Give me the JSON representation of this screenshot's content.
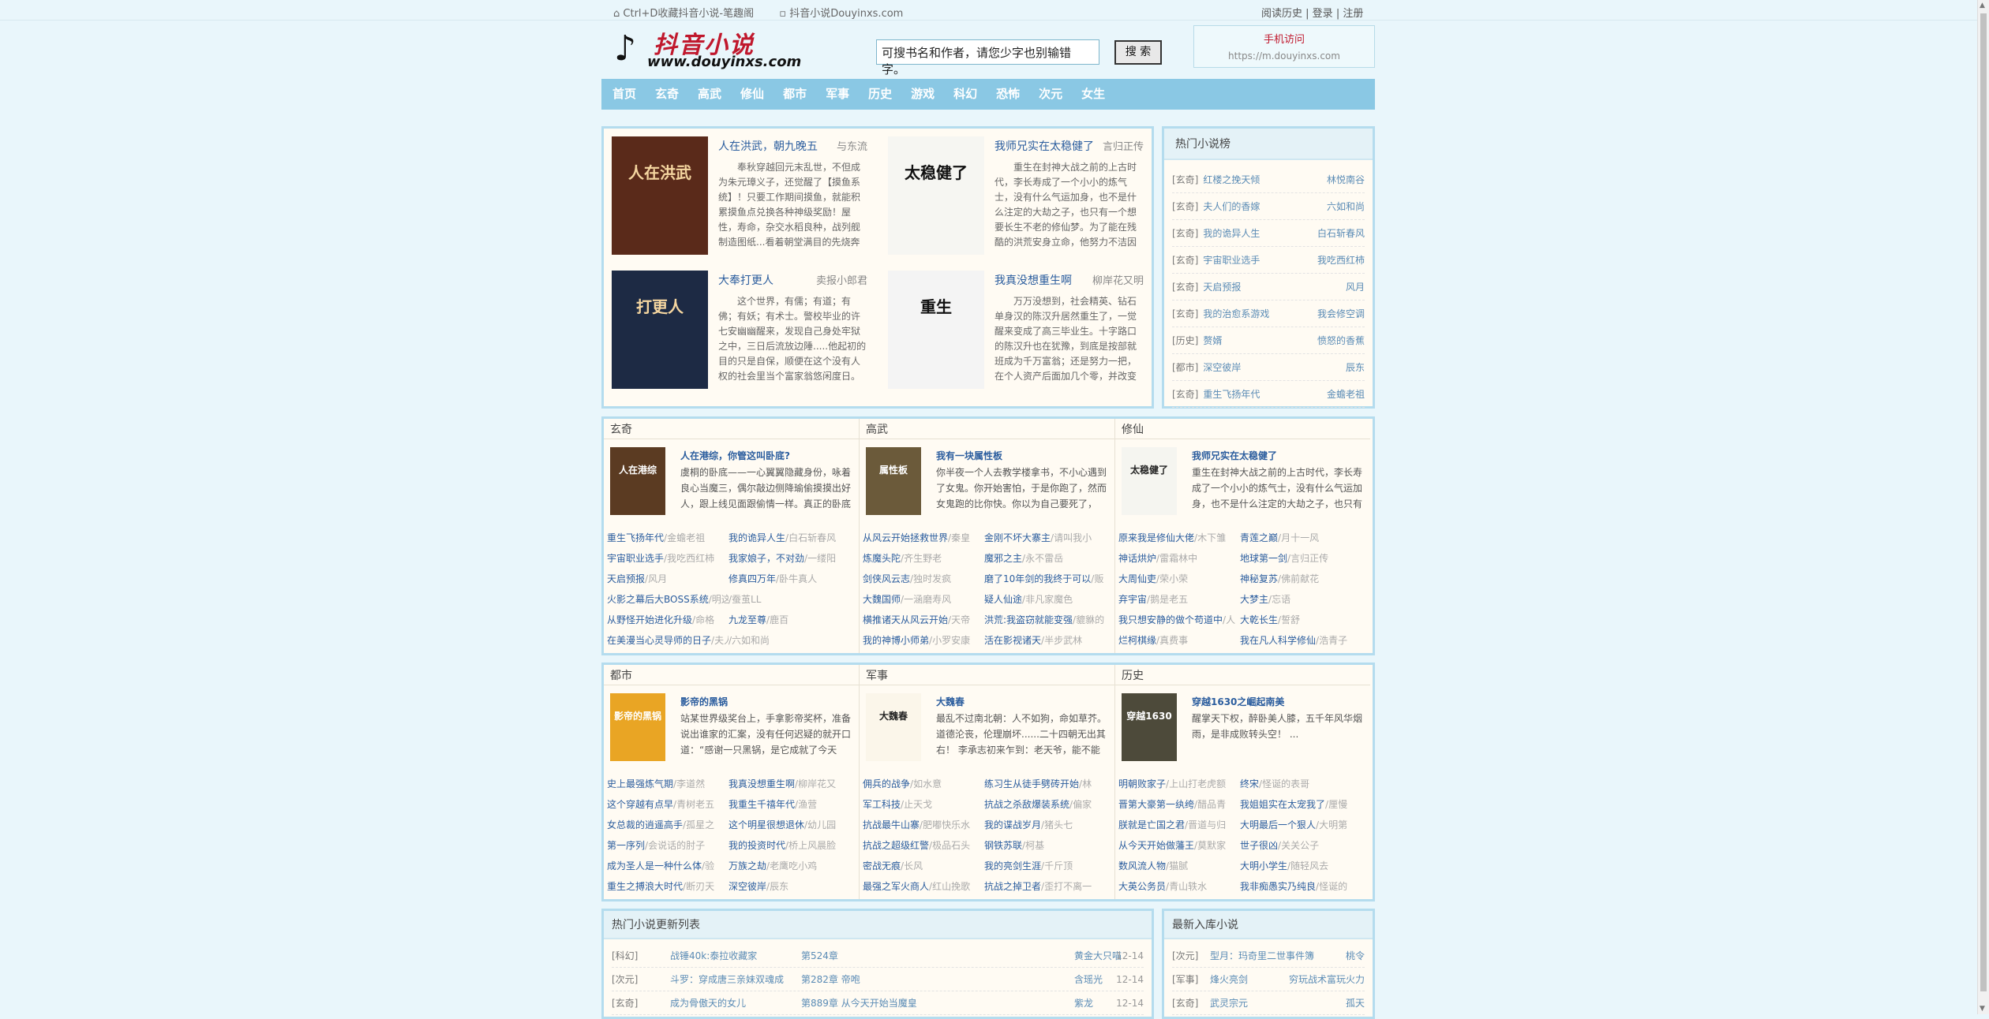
{
  "topbar": {
    "bookmark": "Ctrl+D收藏抖音小说-笔趣阁",
    "site": "抖音小说Douyinxs.com",
    "history": "阅读历史",
    "sep": " | ",
    "login": "登录",
    "register": "注册"
  },
  "logo": {
    "cn": "抖音小说",
    "url": "www.douyinxs.com"
  },
  "search": {
    "value": "可搜书名和作者，请您少字也别输错字。",
    "button": "搜 索"
  },
  "mobile": {
    "title": "手机访问",
    "url": "https://m.douyinxs.com"
  },
  "nav": [
    "首页",
    "玄奇",
    "高武",
    "修仙",
    "都市",
    "军事",
    "历史",
    "游戏",
    "科幻",
    "恐怖",
    "次元",
    "女生"
  ],
  "featured": [
    {
      "title": "人在洪武，朝九晚五",
      "author": "与东流",
      "desc": "奉秋穿越回元末乱世，不但成为朱元璋义子，还觉醒了【摸鱼系统】！只要工作期间摸鱼，就能积累摸鱼点兑换各种神级奖励！屋性，寿命，杂交水稻良种，战列舰制造图纸...看着朝堂满目的先烧奔",
      "cover": "人在洪武",
      "bg": "#5a2a1a"
    },
    {
      "title": "我师兄实在太稳健了",
      "author": "言归正传",
      "desc": "重生在封神大战之前的上古时代，李长寿成了一个小小的炼气士，没有什么气运加身，也不是什么注定的大劫之子，也只有一个想要长生不老的修仙梦。为了能在残酷的洪荒安身立命，他努力不洁因",
      "cover": "太稳健了",
      "bg": "#f6f6f2"
    },
    {
      "title": "大奉打更人",
      "author": "卖报小郎君",
      "desc": "这个世界，有儒；有道；有佛；有妖；有术士。警校毕业的许七安幽幽醒来，发现自己身处牢狱之中，三日后流放边陲.....他起初的目的只是自保，顺便在这个没有人权的社会里当个富家翁悠闲度日。",
      "cover": "打更人",
      "bg": "#1d2a44"
    },
    {
      "title": "我真没想重生啊",
      "author": "柳岸花又明",
      "desc": "万万没想到，社会精英、钻石单身汉的陈汉升居然重生了，一觉醒来变成了高三毕业生。十字路口的陈汉升也在犹豫，到底是按部就班成为千万富翁；还是努力一把，在个人资产后面加几个零，并改变",
      "cover": "重生",
      "bg": "#f4f4f4"
    }
  ],
  "hot": {
    "title": "热门小说榜",
    "rows": [
      {
        "c": "[玄奇]",
        "n": "红楼之挽天倾",
        "a": "林悦南谷"
      },
      {
        "c": "[玄奇]",
        "n": "夫人们的香嫁",
        "a": "六如和尚"
      },
      {
        "c": "[玄奇]",
        "n": "我的诡异人生",
        "a": "白石斩春风"
      },
      {
        "c": "[玄奇]",
        "n": "宇宙职业选手",
        "a": "我吃西红柿"
      },
      {
        "c": "[玄奇]",
        "n": "天启预报",
        "a": "风月"
      },
      {
        "c": "[玄奇]",
        "n": "我的治愈系游戏",
        "a": "我会修空调"
      },
      {
        "c": "[历史]",
        "n": "赘婿",
        "a": "愤怒的香蕉"
      },
      {
        "c": "[都市]",
        "n": "深空彼岸",
        "a": "辰东"
      },
      {
        "c": "[玄奇]",
        "n": "重生飞扬年代",
        "a": "金蟾老祖"
      }
    ]
  },
  "cat1": [
    {
      "name": "玄奇",
      "bt": "人在港综，你管这叫卧底?",
      "bd": "虞桐的卧底——一心翼翼隐藏身份，咏着良心当魔三，偶尔敲边侧降瑜偷摸摸出好人，跟上线见面跟偷情一样。真正的卧底",
      "cover": "人在港综",
      "bg": "#5b3b22",
      "list": [
        [
          "重生飞扬年代",
          "金蟾老祖"
        ],
        [
          "我的诡异人生",
          "白石斩春风"
        ],
        [
          "宇宙职业选手",
          "我吃西红柿"
        ],
        [
          "我家娘子，不对劲",
          "一缕阳"
        ],
        [
          "天启预报",
          "风月"
        ],
        [
          "修真四万年",
          "卧牛真人"
        ],
        [
          "火影之幕后大BOSS系统",
          "明这游戏也太真实了"
        ],
        [
          "",
          "蚕茧LL"
        ],
        [
          "从野怪开始进化升级",
          "命格"
        ],
        [
          "九龙至尊",
          "鹿百"
        ],
        [
          "在美漫当心灵导师的日子",
          "夫人们的香嫁"
        ],
        [
          "",
          "六如和尚"
        ]
      ]
    },
    {
      "name": "高武",
      "bt": "我有一块属性板",
      "bd": "你半夜一个人去教学楼拿书，不小心遇到了女鬼。你开始害怕，于是你跑了，然而女鬼跑的比你快。你以为自己要死了，",
      "cover": "属性板",
      "bg": "#6b5a3a",
      "list": [
        [
          "从风云开始拯救世界",
          "秦皇"
        ],
        [
          "金刚不坏大寨主",
          "请叫我小"
        ],
        [
          "炼魔头陀",
          "齐生野老"
        ],
        [
          "魔邪之主",
          "永不雷岳"
        ],
        [
          "剑侠风云志",
          "独时发疯"
        ],
        [
          "磨了10年剑的我终于可以",
          "贩"
        ],
        [
          "大魏国师",
          "一涵磨寿风"
        ],
        [
          "疑人仙途",
          "非凡家魔色"
        ],
        [
          "横推诸天从风云开始",
          "天帝"
        ],
        [
          "洪荒:我盗窃就能变强",
          "貔貅的"
        ],
        [
          "我的神博小师弟",
          "小罗安康"
        ],
        [
          "活在影视诸天",
          "半步武林"
        ]
      ]
    },
    {
      "name": "修仙",
      "bt": "我师兄实在太稳健了",
      "bd": "重生在封神大战之前的上古时代，李长寿成了一个小小的炼气士，没有什么气运加身，也不是什么注定的大劫之子，也只有",
      "cover": "太稳健了",
      "bg": "#f5f5f0",
      "list": [
        [
          "原来我是修仙大佬",
          "木下雏"
        ],
        [
          "青莲之巅",
          "月十一风"
        ],
        [
          "神话烘炉",
          "雷霜林中"
        ],
        [
          "地球第一剑",
          "言归正传"
        ],
        [
          "大周仙吏",
          "荣小荣"
        ],
        [
          "神秘复苏",
          "佛前献花"
        ],
        [
          "弃宇宙",
          "鹅是老五"
        ],
        [
          "大梦主",
          "忘语"
        ],
        [
          "我只想安静的做个苟道中",
          "人"
        ],
        [
          "大乾长生",
          "誓舒"
        ],
        [
          "烂柯棋缘",
          "真费事"
        ],
        [
          "我在凡人科学修仙",
          "浩青子"
        ]
      ]
    }
  ],
  "cat2": [
    {
      "name": "都市",
      "bt": "影帝的黑锅",
      "bd": "站某世界级奖台上，手拿影帝奖杯，准备说出谁家的汇案，没有任何迟疑的就开口道：“感谢一只黑锅，是它成就了今天",
      "cover": "影帝的黑锅",
      "bg": "#e9a524",
      "list": [
        [
          "史上最强炼气期",
          "李道然"
        ],
        [
          "我真没想重生啊",
          "柳岸花又"
        ],
        [
          "这个穿越有点早",
          "青树老五"
        ],
        [
          "我重生千禧年代",
          "渔营"
        ],
        [
          "女总裁的逍遥高手",
          "孤星之"
        ],
        [
          "这个明星很想退休",
          "幼儿园"
        ],
        [
          "第一序列",
          "会说话的肘子"
        ],
        [
          "我的投资时代",
          "桥上风晨脸"
        ],
        [
          "成为圣人是一种什么体",
          "验"
        ],
        [
          "万族之劫",
          "老鹰吃小鸡"
        ],
        [
          "重生之搏浪大时代",
          "断刃天"
        ],
        [
          "深空彼岸",
          "辰东"
        ]
      ]
    },
    {
      "name": "军事",
      "bt": "大魏春",
      "bd": "最乱不过南北朝：人不如狗，命如草芥。道德沦丧，伦理崩坏......二十四朝无出其右！ 李承志初来乍到：老天爷，能不能",
      "cover": "大魏春",
      "bg": "#fbf6ea",
      "list": [
        [
          "佣兵的战争",
          "如水意"
        ],
        [
          "练习生从徒手劈砖开始",
          "林"
        ],
        [
          "军工科技",
          "止天戈"
        ],
        [
          "抗战之杀敌爆装系统",
          "偏家"
        ],
        [
          "抗战最牛山寨",
          "肥嘟快乐水"
        ],
        [
          "我的谍战岁月",
          "猪头七"
        ],
        [
          "抗战之超级红警",
          "极品石头"
        ],
        [
          "钢铁苏联",
          "柯基"
        ],
        [
          "密战无痕",
          "长风"
        ],
        [
          "我的亮剑生涯",
          "千斤顶"
        ],
        [
          "最强之军火商人",
          "红山挽歌"
        ],
        [
          "抗战之掉卫者",
          "歪打不离一"
        ]
      ]
    },
    {
      "name": "历史",
      "bt": "穿越1630之崛起南美",
      "bd": "醒掌天下权，醉卧美人膝，五千年风华烟雨，是非成败转头空！ ...",
      "cover": "穿越1630",
      "bg": "#4d4a3a",
      "list": [
        [
          "明朝败家子",
          "上山打老虎额"
        ],
        [
          "终宋",
          "怪诞的表哥"
        ],
        [
          "晋第大豪第一纨绔",
          "醋品青"
        ],
        [
          "我姐姐实在太宠我了",
          "厘慢"
        ],
        [
          "朕就是亡国之君",
          "晋道与归"
        ],
        [
          "大明最后一个狠人",
          "大明第"
        ],
        [
          "从今天开始做藩王",
          "莫默家"
        ],
        [
          "世子很凶",
          "关关公子"
        ],
        [
          "数风流人物",
          "猫腻"
        ],
        [
          "大明小学生",
          "随轻风去"
        ],
        [
          "大英公务员",
          "青山轶水"
        ],
        [
          "我非痴愚实乃纯良",
          "怪诞的"
        ]
      ]
    }
  ],
  "updates": {
    "title": "热门小说更新列表",
    "rows": [
      {
        "c": "[科幻]",
        "n": "战锤40k:泰拉收藏家",
        "ch": "第524章",
        "a": "黄金大只喵",
        "d": "12-14"
      },
      {
        "c": "[次元]",
        "n": "斗罗：穿成唐三亲妹双魂成",
        "ch": "第282章 帝咆",
        "a": "含瑶光",
        "d": "12-14"
      },
      {
        "c": "[玄奇]",
        "n": "成为骨傲天的女儿",
        "ch": "第889章 从今天开始当魔皇",
        "a": "紫龙",
        "d": "12-14"
      }
    ]
  },
  "newin": {
    "title": "最新入库小说",
    "rows": [
      {
        "c": "[次元]",
        "n": "型月：玛奇里二世事件簿",
        "a": "桃令"
      },
      {
        "c": "[军事]",
        "n": "烽火亮剑",
        "a": "穷玩战术富玩火力"
      },
      {
        "c": "[玄奇]",
        "n": "武灵宗元",
        "a": "孤天"
      }
    ]
  }
}
